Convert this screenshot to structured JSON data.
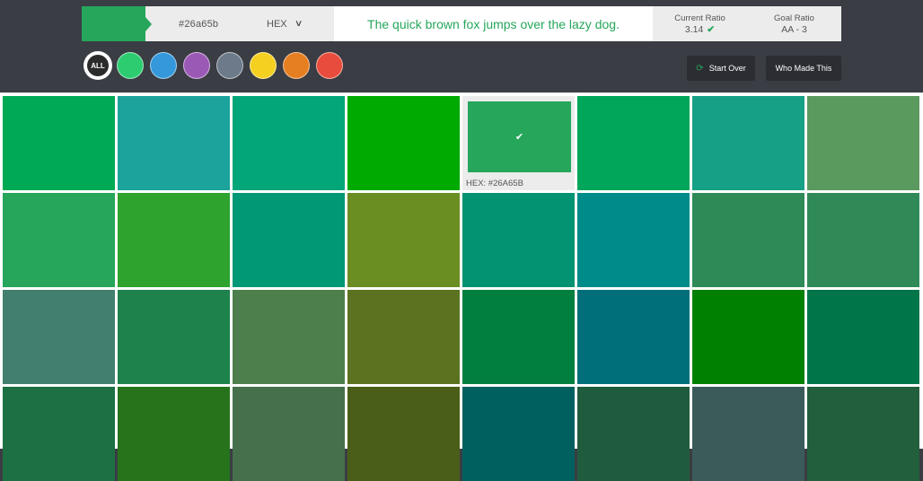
{
  "topbar": {
    "hex_value": "#26a65b",
    "format_label": "HEX",
    "format_chevron": "chevron-down",
    "sample_text": "The quick brown fox jumps over the lazy dog.",
    "current_ratio_label": "Current Ratio",
    "current_ratio_value": "3.14",
    "current_ratio_status": "check-icon",
    "goal_ratio_label": "Goal Ratio",
    "goal_ratio_value": "AA - 3"
  },
  "filters": {
    "all_label": "ALL",
    "colors": [
      {
        "name": "green",
        "hex": "#2ecc71"
      },
      {
        "name": "blue",
        "hex": "#3498db"
      },
      {
        "name": "purple",
        "hex": "#9b59b6"
      },
      {
        "name": "gray",
        "hex": "#6c7a89"
      },
      {
        "name": "yellow",
        "hex": "#f5d020"
      },
      {
        "name": "orange",
        "hex": "#e67e22"
      },
      {
        "name": "red",
        "hex": "#e74c3c"
      }
    ]
  },
  "buttons": {
    "start_over": "Start Over",
    "who_made_this": "Who Made This"
  },
  "grid": {
    "selected_caption": "HEX: #26A65B",
    "rows": [
      [
        "#00aa55",
        "#1ba39c",
        "#03a678",
        "#00aa00",
        "#26a65b",
        "#00a65a",
        "#16a085",
        "#5b9a5f"
      ],
      [
        "#26a65b",
        "#2ea32e",
        "#019875",
        "#6b8e23",
        "#049372",
        "#008b8b",
        "#2e8b57",
        "#308a58"
      ],
      [
        "#427f6e",
        "#1e824c",
        "#4d7f4d",
        "#5b7320",
        "#007f3f",
        "#006f7a",
        "#008000",
        "#00754a"
      ],
      [
        "#1d7044",
        "#26731c",
        "#46704b",
        "#4a5e18",
        "#006060",
        "#1f5c3d",
        "#3b5b5b",
        "#225f3c"
      ]
    ],
    "selected_index": 4
  }
}
